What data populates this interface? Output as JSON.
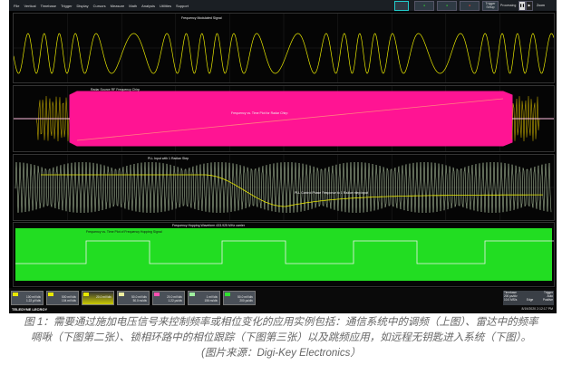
{
  "menu": [
    "File",
    "Vertical",
    "Timebase",
    "Trigger",
    "Display",
    "Cursors",
    "Measure",
    "Math",
    "Analysis",
    "Utilities",
    "Support"
  ],
  "toolbar": {
    "trigger_setup": "Trigger Setup",
    "processing": "Processing",
    "zoom": "Zoom"
  },
  "panels": {
    "fm": {
      "title": "Frequency Modulated Signal"
    },
    "chirp": {
      "title": "Radar Source RF Frequency Chirp",
      "plot": "Frequency vs. Time Plot for Radar Chirp"
    },
    "pll": {
      "title": "PLL Input with 1 Radian Step",
      "plot": "PLL Control Phase Response to 1 Radian step input"
    },
    "hop": {
      "title": "Frequency Hopping Waveform 433.925 MHz carrier",
      "plot": "Frequency vs. Time Plot of Frequency Hopping Signal"
    }
  },
  "channels": [
    {
      "id": "C1",
      "l1": "100 mV/div",
      "l2": "1.22 µV/div",
      "color": "#e8e800"
    },
    {
      "id": "C2",
      "l1": "500 mV/div",
      "l2": "104 mV/div",
      "color": "#e8e800"
    },
    {
      "id": "F1",
      "l1": "20.0 mV/div",
      "l2": "",
      "color": "#e8e800"
    },
    {
      "id": "F2",
      "l1": "50.0 mV/div",
      "l2": "50.0 ns/div",
      "color": "#f0f0a0"
    },
    {
      "id": "F3",
      "l1": "20.0 mV/div",
      "l2": "1.22 µs/div",
      "color": "#ff4fb0"
    },
    {
      "id": "F4",
      "l1": "1 mV/div",
      "l2": "156 ns/div",
      "color": "#a0f0a0"
    },
    {
      "id": "F5",
      "l1": "50.0 mV/div",
      "l2": "200 µs/div",
      "color": "#30e030"
    }
  ],
  "timebase": {
    "label": "Timebase",
    "value": "200 µs/div",
    "rate": "10.0 MS/s",
    "trigger": "Trigger",
    "mode": "Auto",
    "type": "Edge",
    "slope": "Positive"
  },
  "brand": "TELEDYNE LECROY",
  "datetime": "8/19/2020 2:12:17 PM",
  "caption": {
    "line1": "图 1：需要通过施加电压信号来控制频率或相位变化的应用实例包括：通信系统中的调频（上图）、雷达中的频率",
    "line2": "啁啾（下图第二张）、锁相环路中的相位跟踪（下图第三张）以及跳频应用，如远程无钥匙进入系统（下图）。",
    "line3": "(图片来源：Digi-Key Electronics）"
  },
  "colors": {
    "yellow": "#e8e800",
    "pink": "#ff1493",
    "green": "#22dd22"
  }
}
